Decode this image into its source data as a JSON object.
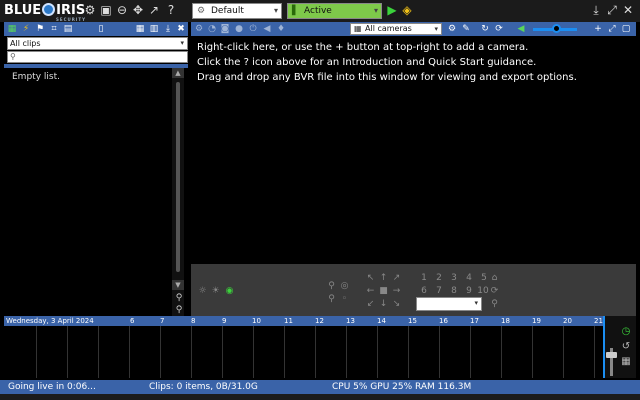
{
  "app": {
    "logo_text_1": "BLUE",
    "logo_text_2": "IRIS",
    "logo_sub": "SECURITY"
  },
  "toolbar": {
    "icons": [
      "settings-icon",
      "cpu-icon",
      "clock-icon",
      "move-icon",
      "chart-icon",
      "help-icon"
    ],
    "profile_value": "Default",
    "schedule_value": "Active",
    "right_icons": [
      "download-icon",
      "expand-icon",
      "close-icon"
    ]
  },
  "left_panel": {
    "clip_filter_value": "All clips",
    "search_placeholder": "",
    "empty_text": "Empty list."
  },
  "main_panel": {
    "camera_group_value": "All cameras",
    "help_lines": [
      "Right-click here, or use the + button at top-right to add a camera.",
      "Click the ? icon above for an Introduction and Quick Start guidance.",
      "Drag and drop any BVR file into this window for viewing and export options."
    ],
    "volume_level": 0.45
  },
  "ptz": {
    "presets_row1": [
      "1",
      "2",
      "3",
      "4",
      "5"
    ],
    "presets_row2": [
      "6",
      "7",
      "8",
      "9",
      "10"
    ],
    "preset_select_value": ""
  },
  "timeline": {
    "date_label": "Wednesday, 3 April 2024",
    "hours": [
      "6",
      "7",
      "8",
      "9",
      "10",
      "11",
      "12",
      "13",
      "14",
      "15",
      "16",
      "17",
      "18",
      "19",
      "20",
      "21"
    ]
  },
  "status_bar": {
    "live_status": "Going live in 0:06...",
    "clips_status": "Clips: 0 items, 0B/31.0G",
    "system_status": "CPU 5% GPU 25% RAM 116.3M"
  },
  "colors": {
    "accent_blue": "#3a63a8",
    "active_green": "#7ec94a",
    "volume_blue": "#1b8ef2"
  }
}
